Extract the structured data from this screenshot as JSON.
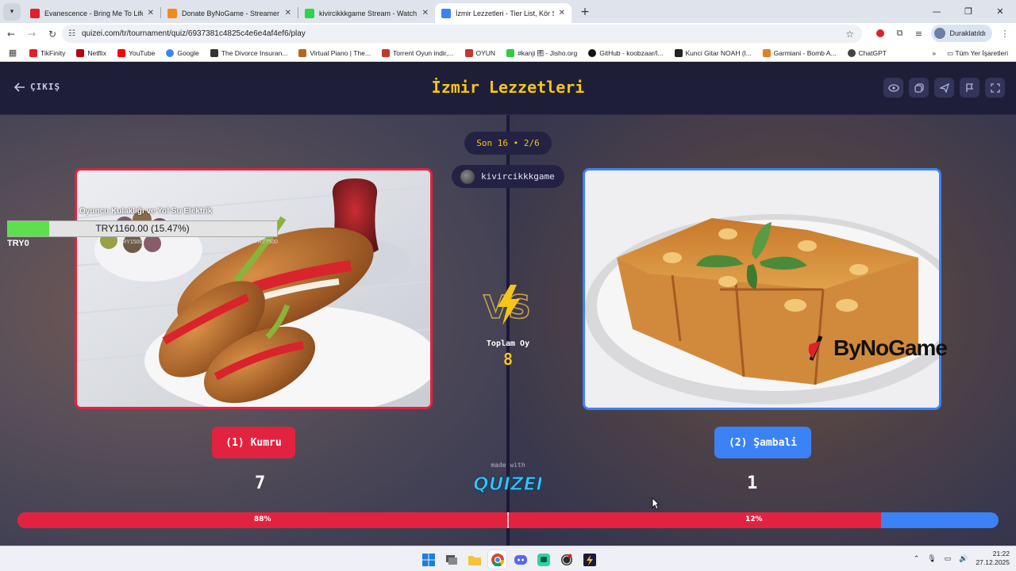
{
  "browser": {
    "tabs": [
      {
        "title": "Evanescence - Bring Me To Life",
        "favicon_color": "#e0202a",
        "active": false
      },
      {
        "title": "Donate ByNoGame - Streamer",
        "favicon_color": "#f08a1c",
        "active": false
      },
      {
        "title": "kivircikkkgame Stream - Watch",
        "favicon_color": "#2bd44b",
        "active": false
      },
      {
        "title": "İzmir Lezzetleri - Tier List, Kör S",
        "favicon_color": "#3b82f6",
        "active": true
      }
    ],
    "url": "quizei.com/tr/tournament/quiz/6937381c4825c4e6e4af4ef6/play",
    "profile_label": "Duraklatıldı",
    "bookmarks": [
      {
        "label": "TikFinity",
        "color": "#e0202a"
      },
      {
        "label": "Netflix",
        "color": "#b20710"
      },
      {
        "label": "YouTube",
        "color": "#ff0000"
      },
      {
        "label": "Google",
        "color": "#4285f4"
      },
      {
        "label": "The Divorce Insuran...",
        "color": "#333333"
      },
      {
        "label": "Virtual Piano | The...",
        "color": "#b46a1c"
      },
      {
        "label": "Torrent Oyun indir,...",
        "color": "#c0392b"
      },
      {
        "label": "OYUN",
        "color": "#c0392b"
      },
      {
        "label": "#kanji 图 - Jisho.org",
        "color": "#2ecc40"
      },
      {
        "label": "GitHub - koobzaar/l...",
        "color": "#111111"
      },
      {
        "label": "Kunci Gitar NOAH (l...",
        "color": "#222222"
      },
      {
        "label": "Garmiani - Bomb A...",
        "color": "#e67e22"
      },
      {
        "label": "ChatGPT",
        "color": "#444444"
      }
    ],
    "all_bookmarks_label": "Tüm Yer İşaretleri"
  },
  "page": {
    "exit_label": "ÇIKIŞ",
    "title": "İzmir Lezzetleri",
    "round_label": "Son 16 • 2/6",
    "streamer_name": "kivircikkkgame",
    "total_votes_label": "Toplam Oy",
    "total_votes": "8",
    "left_option": {
      "label": "(1) Kumru",
      "votes": "7",
      "percent_label": "88%",
      "percent": 0.88,
      "color": "#e2233f"
    },
    "right_option": {
      "label": "(2) Şambali",
      "votes": "1",
      "percent_label": "12%",
      "percent": 0.12,
      "color": "#3b82f6"
    },
    "made_with": "made with",
    "brand_logo": "QUIZEI"
  },
  "donation_overlay": {
    "goal_title": "Oyuncu Kulaklığı ve Yol Su Elektrik",
    "goal_text": "TRY1160.00 (15.47%)",
    "progress": 0.1547,
    "min_label": "TRY0",
    "tick_labels": [
      "TRY1500",
      "TRY7500"
    ],
    "watermark": "ByNoGame"
  },
  "taskbar": {
    "apps": [
      "start-icon",
      "task-view-icon",
      "file-explorer-icon",
      "chrome-icon",
      "discord-icon",
      "chat-icon",
      "obs-icon",
      "app-icon"
    ],
    "time": "21:22",
    "date": "27.12.2025"
  }
}
